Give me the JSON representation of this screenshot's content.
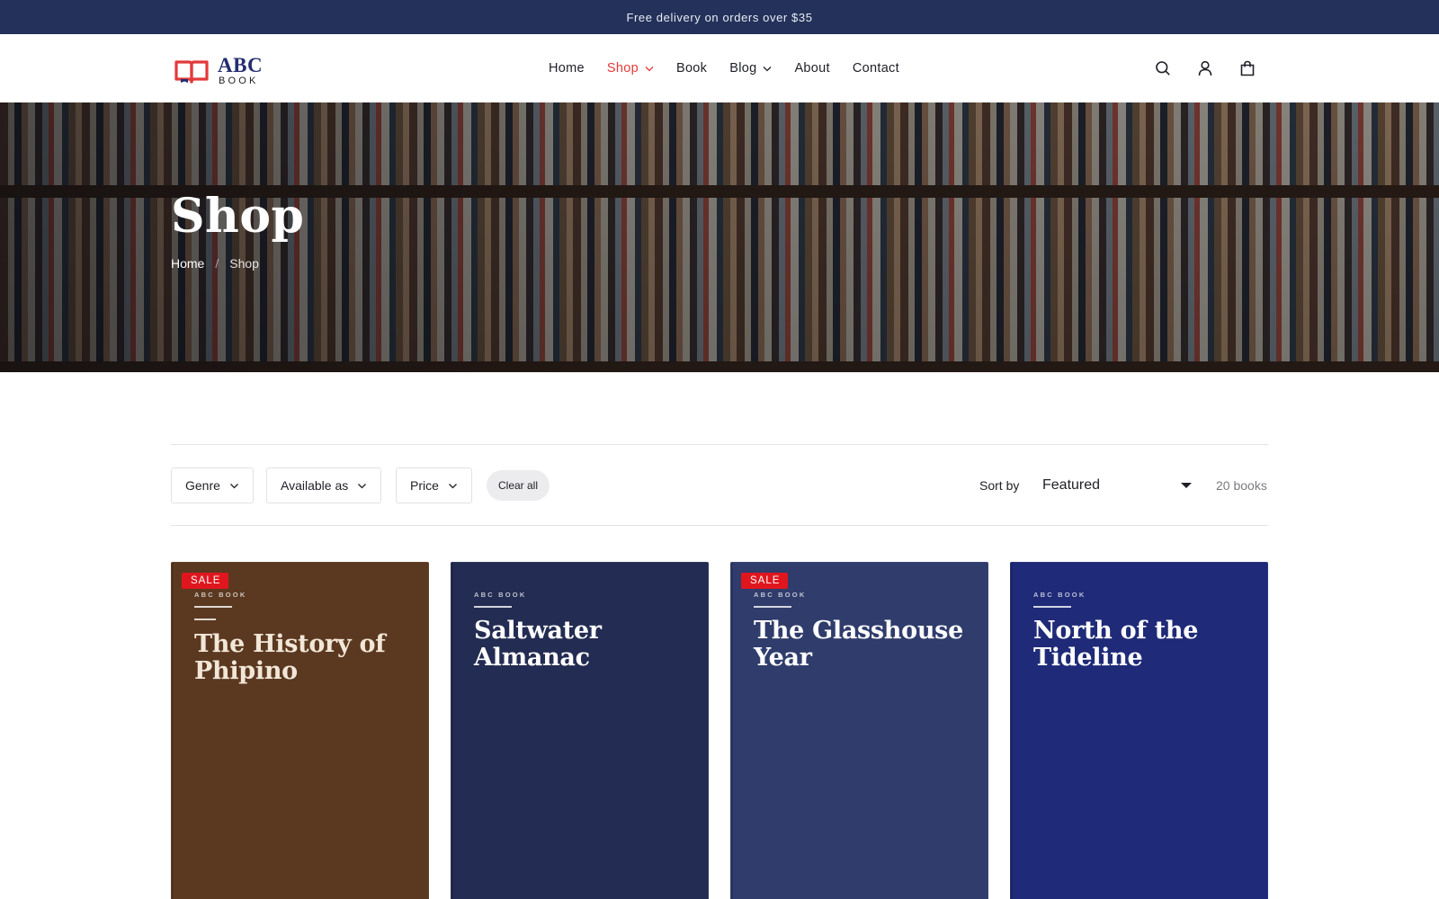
{
  "announcement": {
    "text": "Free delivery on orders over $35"
  },
  "brand": {
    "name": "ABC",
    "subtitle": "BOOK",
    "colors": {
      "primary": "#242d6e",
      "accent": "#e23a3a"
    }
  },
  "nav": {
    "items": [
      {
        "label": "Home",
        "has_dropdown": false,
        "active": false
      },
      {
        "label": "Shop",
        "has_dropdown": true,
        "active": true
      },
      {
        "label": "Book",
        "has_dropdown": false,
        "active": false
      },
      {
        "label": "Blog",
        "has_dropdown": true,
        "active": false
      },
      {
        "label": "About",
        "has_dropdown": false,
        "active": false
      },
      {
        "label": "Contact",
        "has_dropdown": false,
        "active": false
      }
    ]
  },
  "header_icons": [
    "search-icon",
    "user-icon",
    "shopping-bag-icon"
  ],
  "hero": {
    "title": "Shop",
    "breadcrumb": {
      "home": "Home",
      "separator": "/",
      "current": "Shop"
    }
  },
  "filters": {
    "genre": "Genre",
    "available_as": "Available as",
    "price": "Price",
    "clear_all": "Clear all",
    "sort_label": "Sort by",
    "sort_value": "Featured",
    "result_count": "20 books"
  },
  "products": [
    {
      "title": "The History of Phipino",
      "brand": "ABC BOOK",
      "badge": "SALE",
      "cover_color": "#5b3920"
    },
    {
      "title": "Saltwater Almanac",
      "brand": "ABC BOOK",
      "badge": "",
      "cover_color": "#232c52"
    },
    {
      "title": "The Glasshouse Year",
      "brand": "ABC BOOK",
      "badge": "SALE",
      "cover_color": "#2f3c6c"
    },
    {
      "title": "North of the Tideline",
      "brand": "ABC BOOK",
      "badge": "",
      "cover_color": "#1f2a78"
    }
  ]
}
